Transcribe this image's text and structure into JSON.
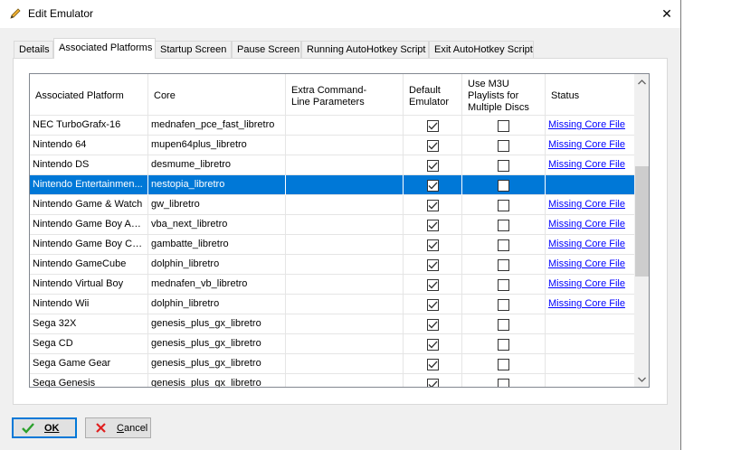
{
  "window": {
    "title": "Edit Emulator",
    "close_glyph": "✕"
  },
  "tabs": [
    {
      "label": "Details",
      "active": false
    },
    {
      "label": "Associated Platforms",
      "active": true
    },
    {
      "label": "Startup Screen",
      "active": false
    },
    {
      "label": "Pause Screen",
      "active": false
    },
    {
      "label": "Running AutoHotkey Script",
      "active": false
    },
    {
      "label": "Exit AutoHotkey Script",
      "active": false
    }
  ],
  "grid": {
    "headers": {
      "platform": "Associated Platform",
      "core": "Core",
      "extra": "Extra Command-Line Parameters",
      "default": "Default Emulator",
      "m3u": "Use M3U Playlists for Multiple Discs",
      "status": "Status"
    },
    "rows": [
      {
        "platform": "NEC TurboGrafx-16",
        "core": "mednafen_pce_fast_libretro",
        "extra": "",
        "default": true,
        "m3u": false,
        "status": "Missing Core File"
      },
      {
        "platform": "Nintendo 64",
        "core": "mupen64plus_libretro",
        "extra": "",
        "default": true,
        "m3u": false,
        "status": "Missing Core File"
      },
      {
        "platform": "Nintendo DS",
        "core": "desmume_libretro",
        "extra": "",
        "default": true,
        "m3u": false,
        "status": "Missing Core File"
      },
      {
        "platform": "Nintendo Entertainmen...",
        "core": "nestopia_libretro",
        "extra": "",
        "default": true,
        "m3u": false,
        "status": "",
        "selected": true
      },
      {
        "platform": "Nintendo Game & Watch",
        "core": "gw_libretro",
        "extra": "",
        "default": true,
        "m3u": false,
        "status": "Missing Core File"
      },
      {
        "platform": "Nintendo Game Boy Ad...",
        "core": "vba_next_libretro",
        "extra": "",
        "default": true,
        "m3u": false,
        "status": "Missing Core File"
      },
      {
        "platform": "Nintendo Game Boy Color",
        "core": "gambatte_libretro",
        "extra": "",
        "default": true,
        "m3u": false,
        "status": "Missing Core File"
      },
      {
        "platform": "Nintendo GameCube",
        "core": "dolphin_libretro",
        "extra": "",
        "default": true,
        "m3u": false,
        "status": "Missing Core File"
      },
      {
        "platform": "Nintendo Virtual Boy",
        "core": "mednafen_vb_libretro",
        "extra": "",
        "default": true,
        "m3u": false,
        "status": "Missing Core File"
      },
      {
        "platform": "Nintendo Wii",
        "core": "dolphin_libretro",
        "extra": "",
        "default": true,
        "m3u": false,
        "status": "Missing Core File"
      },
      {
        "platform": "Sega 32X",
        "core": "genesis_plus_gx_libretro",
        "extra": "",
        "default": true,
        "m3u": false,
        "status": ""
      },
      {
        "platform": "Sega CD",
        "core": "genesis_plus_gx_libretro",
        "extra": "",
        "default": true,
        "m3u": false,
        "status": ""
      },
      {
        "platform": "Sega Game Gear",
        "core": "genesis_plus_gx_libretro",
        "extra": "",
        "default": true,
        "m3u": false,
        "status": ""
      },
      {
        "platform": "Sega Genesis",
        "core": "genesis_plus_gx_libretro",
        "extra": "",
        "default": true,
        "m3u": false,
        "status": ""
      }
    ]
  },
  "buttons": {
    "ok": {
      "label": "OK"
    },
    "cancel": {
      "mnemonic": "C",
      "rest": "ancel"
    }
  },
  "colors": {
    "selection": "#0078d7",
    "link": "#0000ff",
    "ok_icon": "#2ca02c",
    "cancel_icon": "#e02020"
  },
  "icons": {
    "title": "pencil-icon",
    "ok": "checkmark-icon",
    "cancel": "x-icon"
  }
}
